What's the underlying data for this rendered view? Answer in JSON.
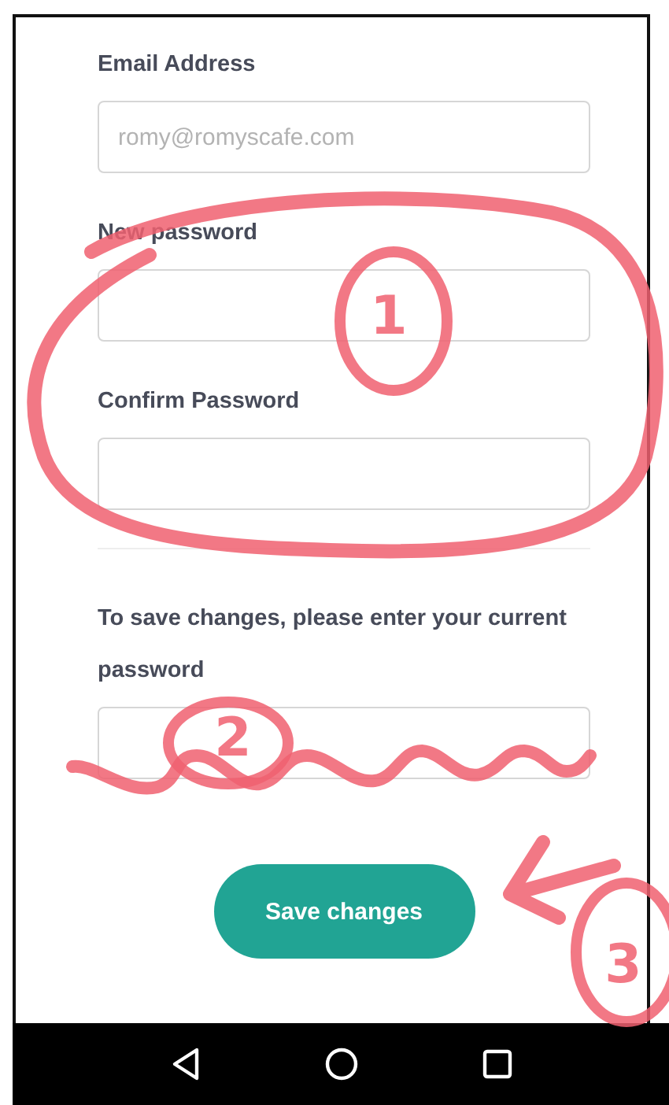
{
  "form": {
    "fields": [
      {
        "label": "Email Address",
        "placeholder": "romy@romyscafe.com"
      },
      {
        "label": "New password"
      },
      {
        "label": "Confirm Password"
      }
    ],
    "current_password": {
      "label": "To save changes, please enter your current password"
    },
    "save_button": "Save changes"
  },
  "annotations": [
    {
      "kind": "ellipse"
    },
    {
      "kind": "number",
      "text": "1"
    },
    {
      "kind": "number",
      "text": "2"
    },
    {
      "kind": "wave"
    },
    {
      "kind": "arrow"
    },
    {
      "kind": "number",
      "text": "3"
    }
  ]
}
